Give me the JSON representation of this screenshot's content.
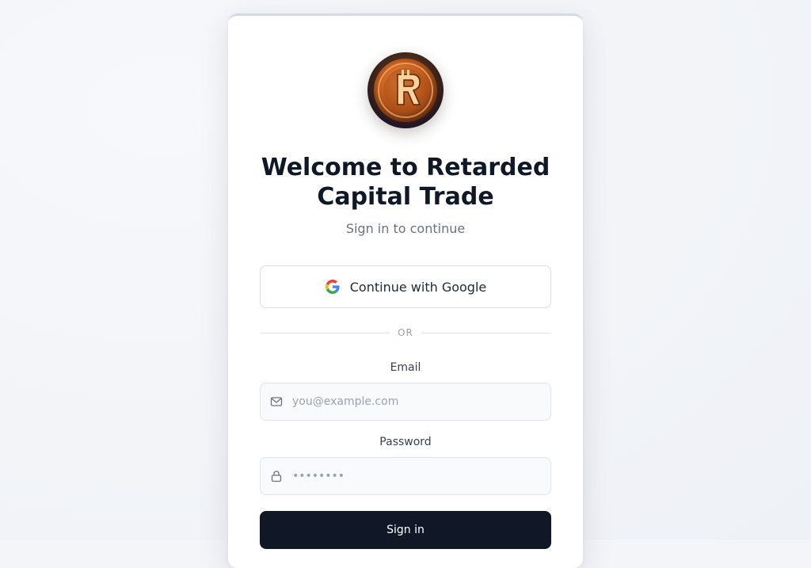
{
  "card": {
    "title": "Welcome to Retarded Capital Trade",
    "subtitle": "Sign in to continue",
    "logo_icon": "coin-r-logo-icon"
  },
  "google": {
    "label": "Continue with Google",
    "icon": "google-icon"
  },
  "divider": {
    "label": "OR"
  },
  "email": {
    "label": "Email",
    "placeholder": "you@example.com",
    "icon": "mail-icon"
  },
  "password": {
    "label": "Password",
    "placeholder": "••••••••",
    "icon": "lock-icon"
  },
  "signin": {
    "label": "Sign in"
  },
  "colors": {
    "primary_button": "#101828",
    "title": "#101828",
    "logo_orange": "#e8742a"
  }
}
